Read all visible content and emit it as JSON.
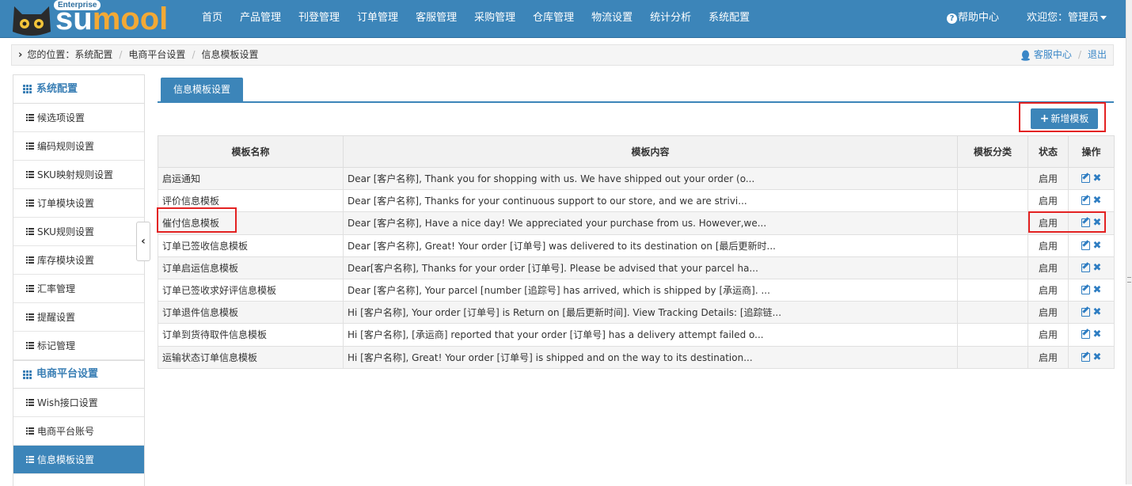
{
  "brand": {
    "logo_text_su": "su",
    "logo_text_mool": "mool",
    "edition": "Enterprise",
    "accent_color": "#3c85b9",
    "logo_orange": "#f3a935"
  },
  "nav": {
    "items": [
      "首页",
      "产品管理",
      "刊登管理",
      "订单管理",
      "客服管理",
      "采购管理",
      "仓库管理",
      "物流设置",
      "统计分析",
      "系统配置"
    ],
    "help_label": "帮助中心",
    "user_label": "欢迎您：管理员"
  },
  "breadcrumb": {
    "location": "您的位置：系统配置",
    "level2": "电商平台设置",
    "level3": "信息模板设置",
    "service_center": "客服中心",
    "logout": "退出"
  },
  "sidebar": {
    "group1": {
      "title": "系统配置",
      "items": [
        "候选项设置",
        "编码规则设置",
        "SKU映射规则设置",
        "订单模块设置",
        "SKU规则设置",
        "库存模块设置",
        "汇率管理",
        "提醒设置",
        "标记管理"
      ]
    },
    "group2": {
      "title": "电商平台设置",
      "items": [
        "Wish接口设置",
        "电商平台账号",
        "信息模板设置"
      ]
    },
    "collapse_glyph": "‹"
  },
  "main": {
    "tab_label": "信息模板设置",
    "add_button_label": "新增模板",
    "table": {
      "headers": [
        "模板名称",
        "模板内容",
        "模板分类",
        "状态",
        "操作"
      ],
      "rows": [
        {
          "name": "启运通知",
          "content": "Dear [客户名称], Thank you for shopping with us. We have shipped out your order (o...",
          "category": "",
          "status": "启用"
        },
        {
          "name": "评价信息模板",
          "content": "Dear [客户名称], Thanks for your continuous support to our store, and we are strivi...",
          "category": "",
          "status": "启用"
        },
        {
          "name": "催付信息模板",
          "content": "Dear [客户名称], Have a nice day! We appreciated your purchase from us. However,we...",
          "category": "",
          "status": "启用"
        },
        {
          "name": "订单已签收信息模板",
          "content": "Dear [客户名称], Great! Your order [订单号] was delivered to its destination on [最后更新时...",
          "category": "",
          "status": "启用"
        },
        {
          "name": "订单启运信息模板",
          "content": "Dear[客户名称], Thanks for your order [订单号]. Please be advised that your parcel ha...",
          "category": "",
          "status": "启用"
        },
        {
          "name": "订单已签收求好评信息模板",
          "content": "Dear [客户名称], Your parcel [number [追踪号] has arrived, which is shipped by [承运商]. ...",
          "category": "",
          "status": "启用"
        },
        {
          "name": "订单退件信息模板",
          "content": "Hi [客户名称], Your order [订单号] is Return on [最后更新时间]. View Tracking Details: [追踪链...",
          "category": "",
          "status": "启用"
        },
        {
          "name": "订单到货待取件信息模板",
          "content": "Hi [客户名称], [承运商] reported that your order [订单号] has a delivery attempt failed o...",
          "category": "",
          "status": "启用"
        },
        {
          "name": "运输状态订单信息模板",
          "content": "Hi [客户名称], Great! Your order [订单号] is shipped and on the way to its destination...",
          "category": "",
          "status": "启用"
        }
      ]
    }
  }
}
